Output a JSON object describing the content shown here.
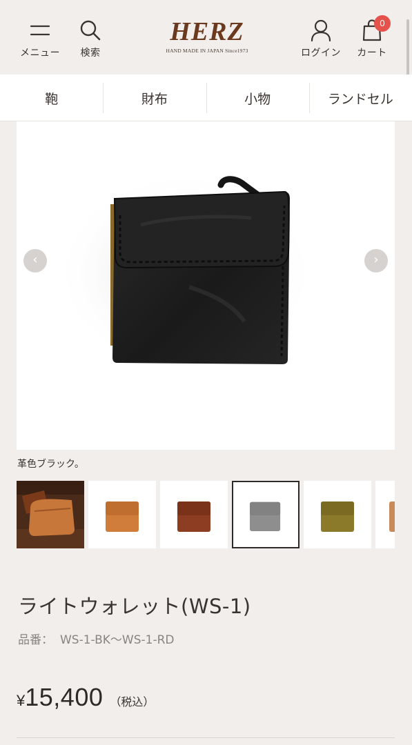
{
  "header": {
    "menu_label": "メニュー",
    "search_label": "検索",
    "login_label": "ログイン",
    "cart_label": "カート",
    "cart_count": "0",
    "logo_text": "HERZ",
    "logo_tagline": "HAND MADE IN JAPAN Since1973"
  },
  "categories": [
    {
      "label": "鞄"
    },
    {
      "label": "財布"
    },
    {
      "label": "小物"
    },
    {
      "label": "ランドセル"
    }
  ],
  "gallery": {
    "caption": "革色ブラック。",
    "prev_arrow": "‹",
    "next_arrow": "›",
    "thumbnails": [
      {
        "color": "#8b4a22"
      },
      {
        "color": "#d07d3c"
      },
      {
        "color": "#8c3d22"
      },
      {
        "color": "#8e8e8e"
      },
      {
        "color": "#8a7a2a"
      },
      {
        "color": "#c98a5a"
      }
    ],
    "selected_index": 3,
    "main_item_color": "#1f1f1f"
  },
  "product": {
    "title": "ライトウォレット(WS-1)",
    "sku_label": "品番：",
    "sku_value": "WS-1-BK〜WS-1-RD",
    "price_symbol": "¥",
    "price_amount": "15,400",
    "price_tax": "（税込）"
  },
  "colors": {
    "background": "#f1eeeb",
    "logo_brown": "#6b3a1e",
    "badge_red": "#e5524b"
  }
}
